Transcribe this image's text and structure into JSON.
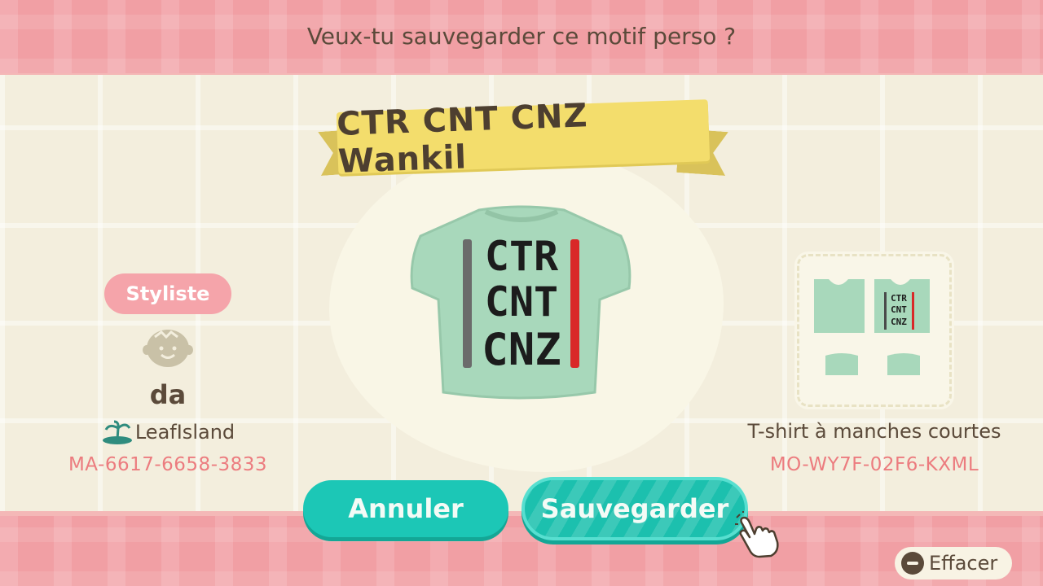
{
  "prompt": "Veux-tu sauvegarder ce motif perso ?",
  "design_title": "CTR CNT CNZ Wankil",
  "shirt_text": [
    "CTR",
    "CNT",
    "CNZ"
  ],
  "creator": {
    "role_label": "Styliste",
    "name": "da",
    "island": "LeafIsland",
    "code": "MA-6617-6658-3833"
  },
  "item": {
    "type": "T-shirt à manches courtes",
    "code": "MO-WY7F-02F6-KXML"
  },
  "buttons": {
    "cancel": "Annuler",
    "save": "Sauvegarder"
  },
  "erase_label": "Effacer",
  "colors": {
    "shirt": "#a8d8bb",
    "stripe_gray": "#6b6b6b",
    "stripe_red": "#d92828",
    "accent_teal": "#1cc7b6",
    "code_pink": "#ec7c7f"
  }
}
